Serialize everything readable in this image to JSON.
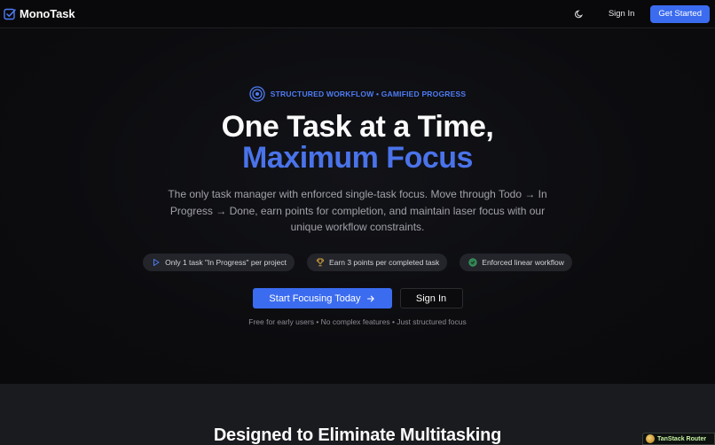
{
  "header": {
    "brand_name": "MonoTask",
    "signin_label": "Sign In",
    "cta_label": "Get Started"
  },
  "hero": {
    "eyebrow": "STRUCTURED WORKFLOW • GAMIFIED PROGRESS",
    "headline_line1": "One Task at a Time,",
    "headline_line2": "Maximum Focus",
    "subtext": "The only task manager with enforced single-task focus. Move through Todo → In Progress → Done, earn points for completion, and maintain laser focus with our unique workflow constraints.",
    "pills": [
      {
        "label": "Only 1 task \"In Progress\" per project",
        "icon": "play-icon"
      },
      {
        "label": "Earn 3 points per completed task",
        "icon": "trophy-icon"
      },
      {
        "label": "Enforced linear workflow",
        "icon": "check-circle-icon"
      }
    ],
    "primary_cta": "Start Focusing Today",
    "secondary_cta": "Sign In",
    "footnote": "Free for early users • No complex features • Just structured focus"
  },
  "features": {
    "title": "Designed to Eliminate Multitasking"
  },
  "devtools": {
    "label": "TanStack Router"
  },
  "colors": {
    "accent": "#3b6cf0",
    "headline_accent": "#4a73ea",
    "background": "#0a0a0b"
  }
}
